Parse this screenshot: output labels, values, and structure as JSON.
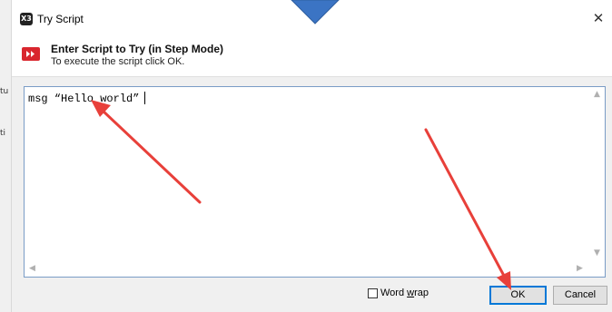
{
  "window": {
    "title": "Try Script",
    "close_glyph": "✕",
    "app_icon_text": "X3"
  },
  "header": {
    "title": "Enter Script to Try (in Step Mode)",
    "subtitle": "To execute the script click OK.",
    "icon": "step-forward-icon"
  },
  "editor": {
    "content": "msg “Hello world”",
    "scroll_up": "▲",
    "scroll_down": "▼",
    "scroll_left": "◀",
    "scroll_right": "▶"
  },
  "word_wrap": {
    "label_prefix": "Word ",
    "label_accel": "w",
    "label_suffix": "rap",
    "checked": false
  },
  "buttons": {
    "ok": "OK",
    "cancel": "Cancel"
  },
  "background_app": {
    "glyph_1": "tu",
    "glyph_2": "ti"
  },
  "colors": {
    "accent_red": "#d9262e",
    "arrow_red": "#e8403a",
    "callout_blue": "#3b74c4",
    "focus_blue": "#0078d7"
  }
}
